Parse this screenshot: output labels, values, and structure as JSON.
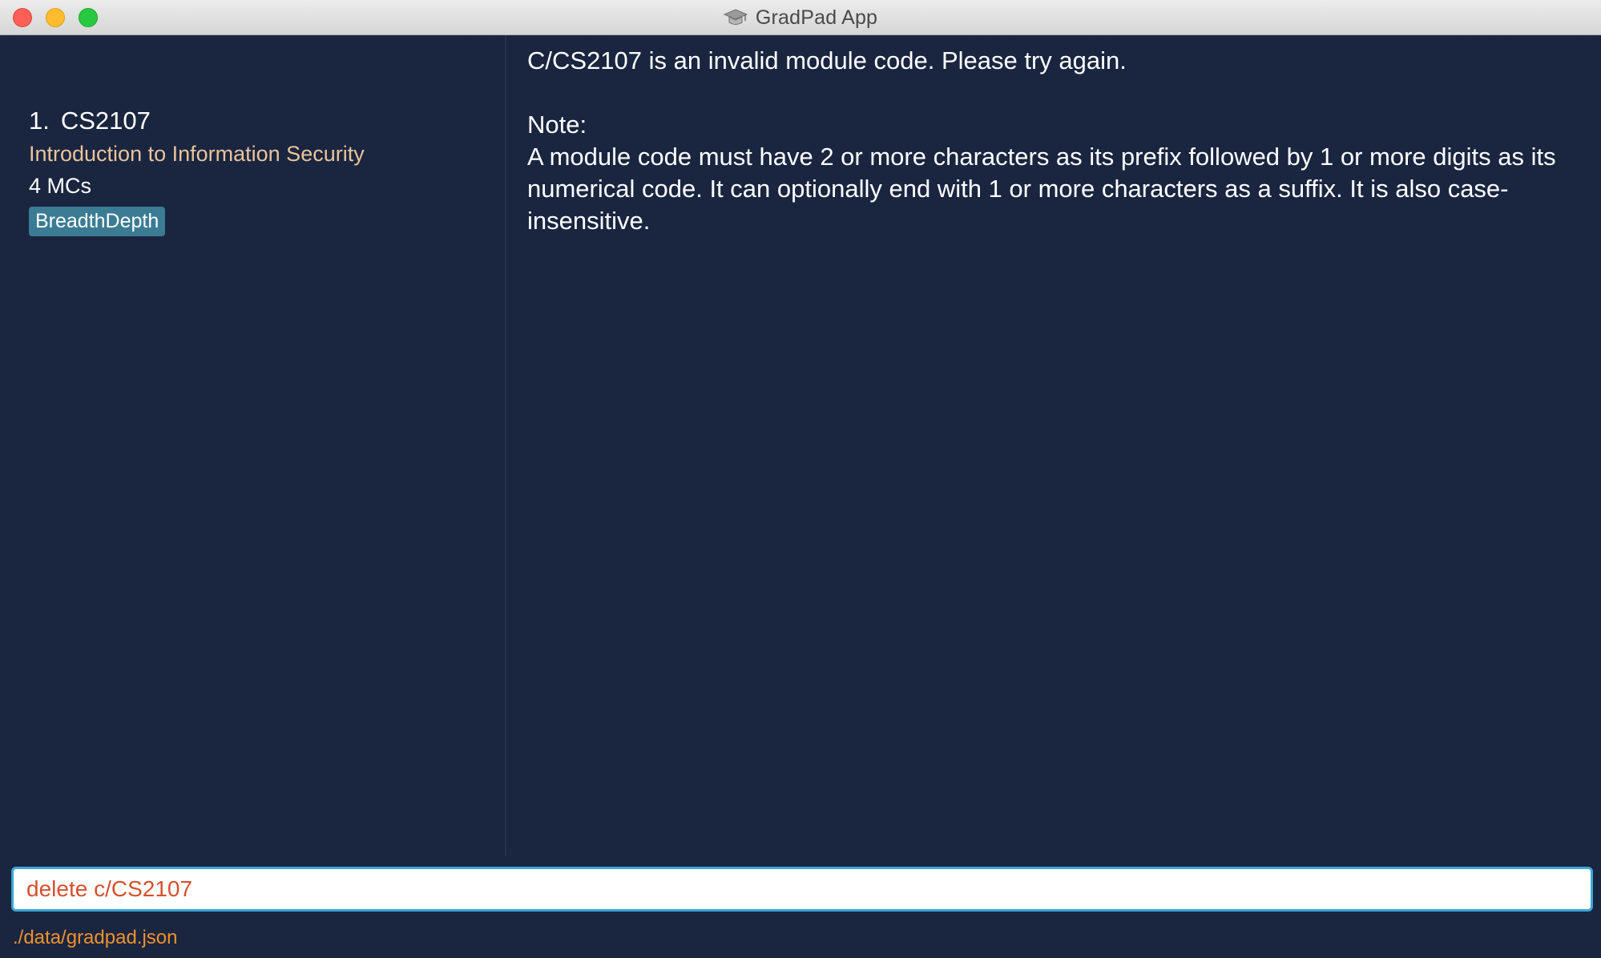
{
  "window": {
    "title": "GradPad App",
    "app_icon": "graduation-cap-icon"
  },
  "modules": [
    {
      "index": "1.",
      "code": "CS2107",
      "title": "Introduction to Information Security",
      "credits": "4 MCs",
      "tags": [
        "BreadthDepth"
      ]
    }
  ],
  "result": {
    "message": "C/CS2107 is an invalid module code. Please try again.\n\nNote:\nA module code must have 2 or more characters as its prefix followed by 1 or more digits as its numerical code. It can optionally end with 1 or more characters as a suffix. It is also case-insensitive."
  },
  "command": {
    "value": "delete c/CS2107"
  },
  "status": {
    "file_path": "./data/gradpad.json"
  },
  "colors": {
    "background": "#1a2540",
    "module_title": "#e9c49a",
    "tag_bg": "#3b7b94",
    "command_text": "#d4502e",
    "status_text": "#f0922b",
    "input_border": "#3aa7d6"
  }
}
